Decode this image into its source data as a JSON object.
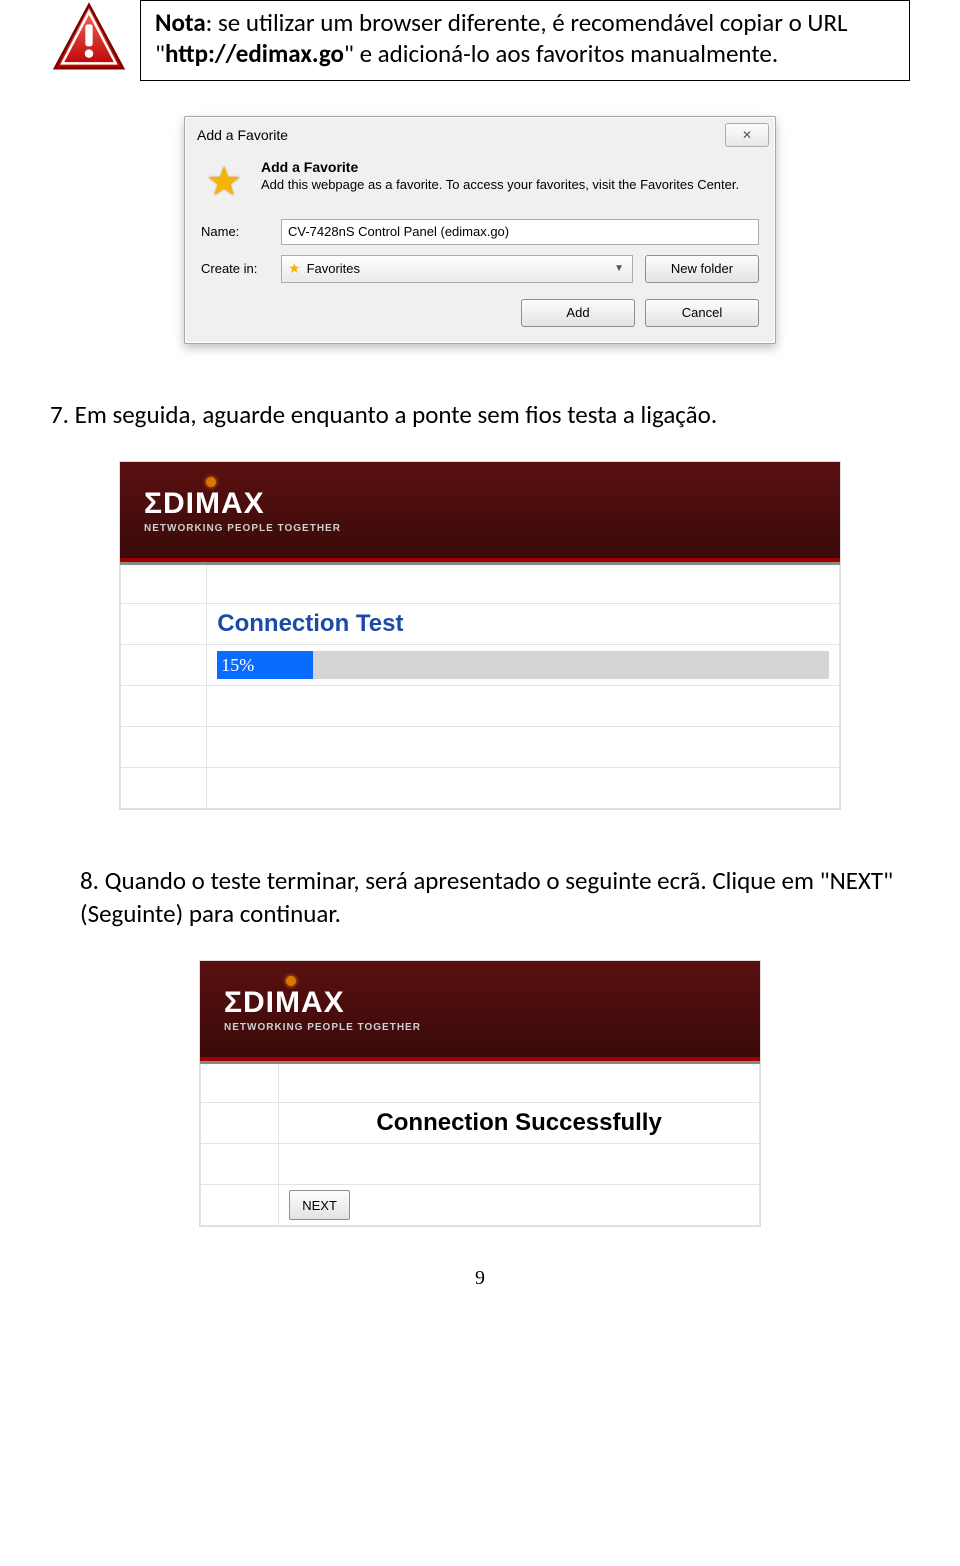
{
  "note": {
    "label": "Nota",
    "text_a": ": se utilizar um browser diferente, é recomendável copiar o URL \"",
    "url": "http://edimax.go",
    "text_b": "\" e adicioná-lo aos favoritos manualmente."
  },
  "dialog": {
    "title": "Add a Favorite",
    "close": "✕",
    "heading": "Add a Favorite",
    "subtext": "Add this webpage as a favorite. To access your favorites, visit the Favorites Center.",
    "name_label": "Name:",
    "name_value": "CV-7428nS Control Panel (edimax.go)",
    "create_label": "Create in:",
    "create_value": "Favorites",
    "new_folder": "New folder",
    "add": "Add",
    "cancel": "Cancel"
  },
  "step7": "7. Em seguida, aguarde enquanto a ponte sem fios testa a ligação.",
  "edimax": {
    "brand": "ΣDIMAX",
    "tagline": "NETWORKING PEOPLE TOGETHER"
  },
  "panel_test": {
    "title": "Connection Test",
    "progress_label": "15%"
  },
  "step8": "8. Quando o teste terminar, será apresentado o seguinte ecrã. Clique em \"NEXT\" (Seguinte) para continuar.",
  "panel_ok": {
    "title": "Connection Successfully",
    "next": "NEXT"
  },
  "page_number": "9"
}
